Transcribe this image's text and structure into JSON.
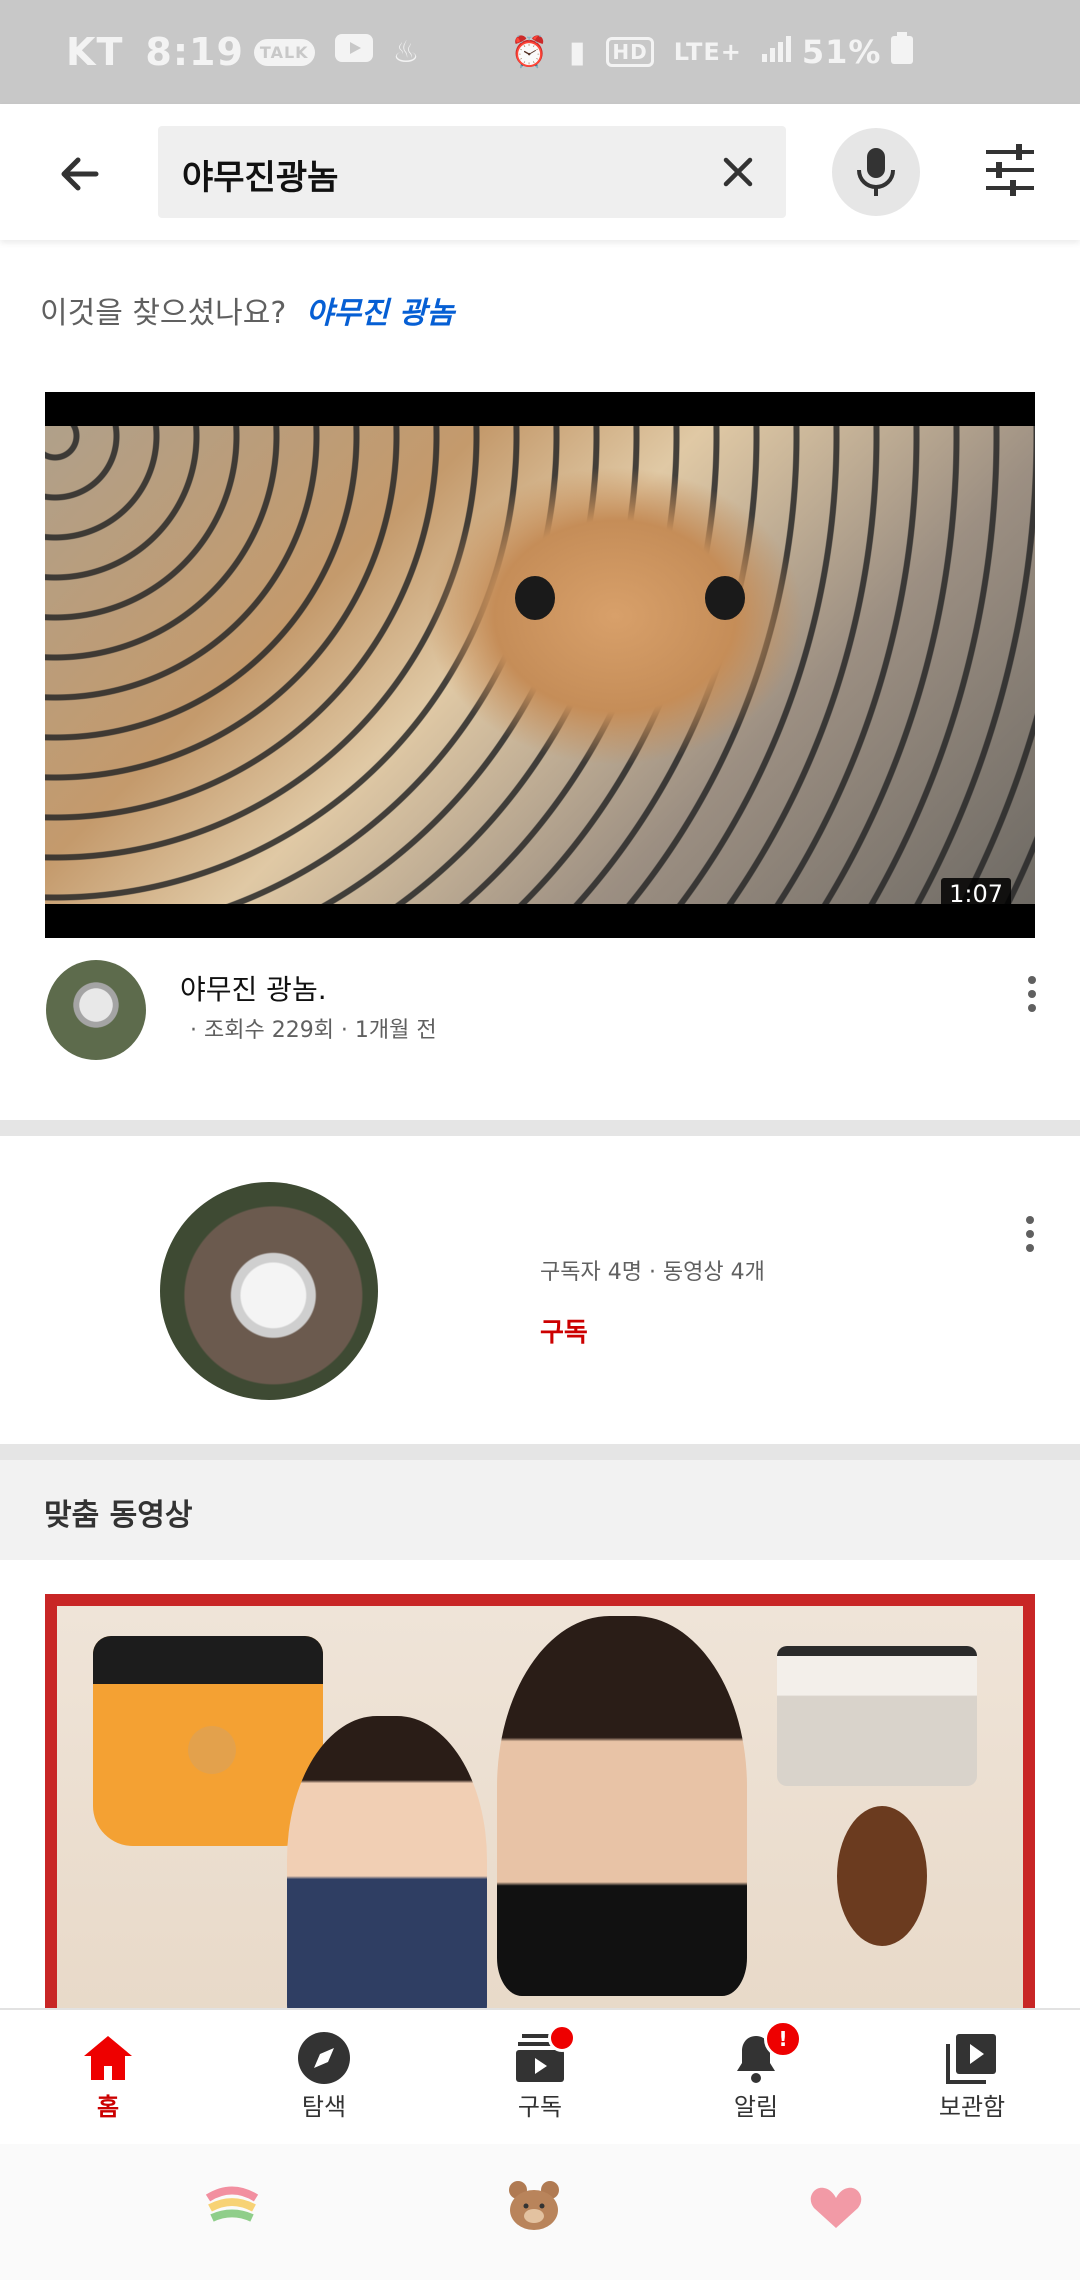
{
  "status_bar": {
    "carrier": "KT",
    "time": "8:19",
    "talk_badge": "TALK",
    "hd_badge": "HD",
    "network": "LTE+",
    "battery": "51%"
  },
  "search": {
    "query": "야무진광놈"
  },
  "did_you_mean": {
    "prompt": "이것을 찾으셨나요?",
    "suggestion": "야무진 광놈"
  },
  "video_result": {
    "duration": "1:07",
    "title": "야무진 광놈.",
    "meta": "· 조회수 229회 · 1개월 전"
  },
  "channel_result": {
    "stats": "구독자 4명 · 동영상 4개",
    "subscribe_label": "구독"
  },
  "recommended": {
    "section_title": "맞춤 동영상"
  },
  "bottom_nav": {
    "items": [
      {
        "label": "홈",
        "icon": "home-icon",
        "active": true
      },
      {
        "label": "탐색",
        "icon": "explore-icon",
        "active": false
      },
      {
        "label": "구독",
        "icon": "subscriptions-icon",
        "active": false
      },
      {
        "label": "알림",
        "icon": "notifications-icon",
        "active": false,
        "badge": "!"
      },
      {
        "label": "보관함",
        "icon": "library-icon",
        "active": false
      }
    ]
  },
  "colors": {
    "accent_red": "#cc0000",
    "link_blue": "#065fd4",
    "muted_text": "#606060"
  }
}
